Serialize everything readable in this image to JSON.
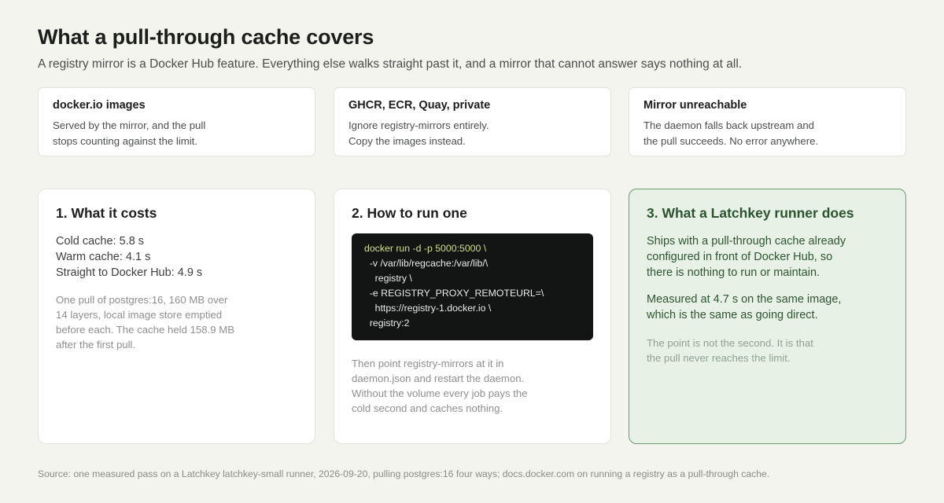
{
  "header": {
    "title": "What a pull-through cache covers",
    "subtitle": "A registry mirror is a Docker Hub feature. Everything else walks straight past it, and a mirror that cannot answer says nothing at all."
  },
  "top_cards": [
    {
      "title": "docker.io images",
      "body": "Served by the mirror, and the pull\nstops counting against the limit."
    },
    {
      "title": "GHCR, ECR, Quay, private",
      "body": "Ignore registry-mirrors entirely.\nCopy the images instead."
    },
    {
      "title": "Mirror unreachable",
      "body": "The daemon falls back upstream and\nthe pull succeeds. No error anywhere."
    }
  ],
  "costs": {
    "title": "1. What it costs",
    "lines": [
      "Cold cache: 5.8 s",
      "Warm cache: 4.1 s",
      "Straight to Docker Hub: 4.9 s"
    ],
    "note": "One pull of postgres:16, 160 MB over\n14 layers, local image store emptied\nbefore each. The cache held 158.9 MB\nafter the first pull."
  },
  "run": {
    "title": "2. How to run one",
    "code_first": "docker run -d -p 5000:5000 \\",
    "code_rest": "  -v /var/lib/regcache:/var/lib/\\\n    registry \\\n  -e REGISTRY_PROXY_REMOTEURL=\\\n    https://registry-1.docker.io \\\n  registry:2",
    "note": "Then point registry-mirrors at it in\ndaemon.json and restart the daemon.\nWithout the volume every job pays the\ncold second and caches nothing."
  },
  "runner": {
    "title": "3. What a Latchkey runner does",
    "p1": "Ships with a pull-through cache already\nconfigured in front of Docker Hub, so\nthere is nothing to run or maintain.",
    "p2": "Measured at 4.7 s on the same image,\nwhich is the same as going direct.",
    "note": "The point is not the second. It is that\nthe pull never reaches the limit."
  },
  "footer": {
    "source": "Source: one measured pass on a Latchkey latchkey-small runner, 2026-09-20, pulling postgres:16 four ways; docs.docker.com on running a registry as a pull-through cache."
  }
}
